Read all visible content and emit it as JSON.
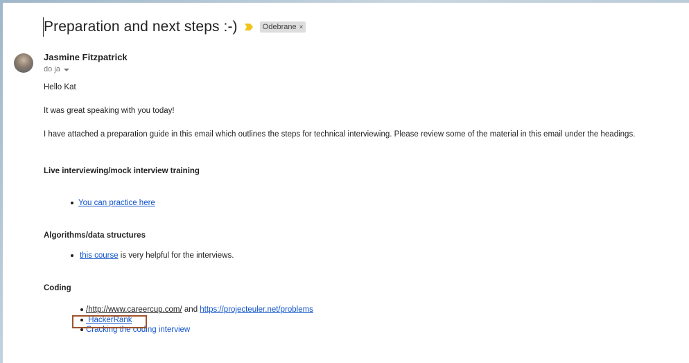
{
  "email": {
    "subject": "Preparation and next steps :-)",
    "label": "Odebrane",
    "label_close": "×",
    "sender": "Jasmine Fitzpatrick",
    "recipient": "do ja"
  },
  "body": {
    "greeting": "Hello Kat",
    "line1": "It was great speaking with you today!",
    "line2": "I have attached a preparation guide in this email which outlines the steps for technical interviewing.  Please review some of the material in this email under the headings.",
    "section1": {
      "heading": "Live interviewing/mock interview training",
      "link": "You can practice here"
    },
    "section2": {
      "heading": "Algorithms/data structures",
      "link": "this course",
      "suffix": " is very helpful for the interviews."
    },
    "section3": {
      "heading": "Coding",
      "item1_link_a": "/http://www.careercup.com/",
      "item1_and": " and ",
      "item1_link_b": " https://projecteuler.net/problems ",
      "item2_link": " HackerRank",
      "item3_link": "Cracking the coding interview"
    }
  },
  "colors": {
    "link": "#1155cc",
    "highlight": "#a0522d",
    "importance": "#f0c419"
  },
  "icons": {
    "importance": "importance-marker-icon",
    "avatar": "sender-avatar",
    "caret": "chevron-down-icon"
  }
}
